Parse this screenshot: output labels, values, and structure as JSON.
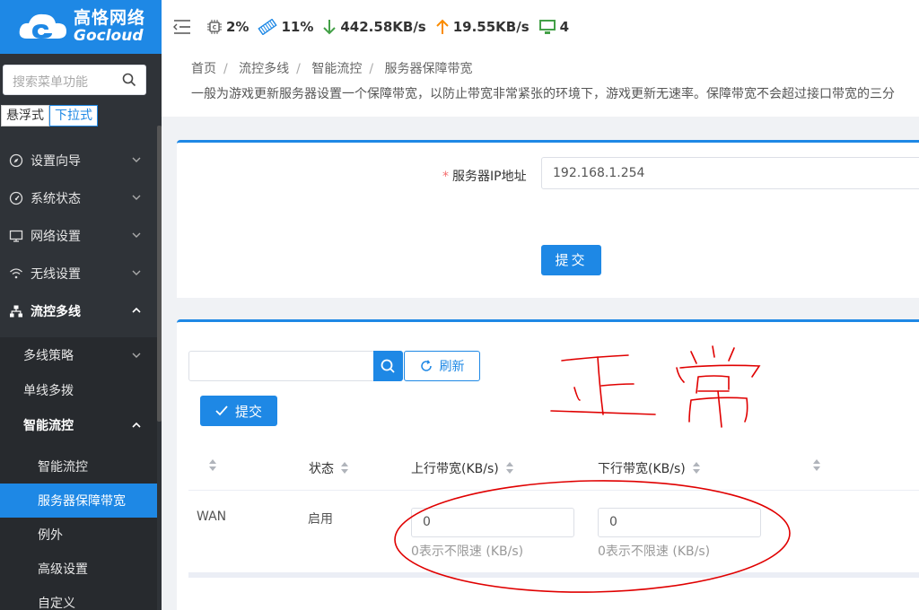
{
  "brand": {
    "name_cn": "高恪网络",
    "name_en": "Gocloud"
  },
  "header": {
    "cpu": "2%",
    "mem": "11%",
    "down": "442.58KB/s",
    "up": "19.55KB/s",
    "clients": "4"
  },
  "sidebar": {
    "search_placeholder": "搜索菜单功能",
    "modes": [
      "悬浮式",
      "下拉式"
    ],
    "items": [
      {
        "label": "设置向导",
        "icon": "compass-icon"
      },
      {
        "label": "系统状态",
        "icon": "gauge-icon"
      },
      {
        "label": "网络设置",
        "icon": "monitor-icon"
      },
      {
        "label": "无线设置",
        "icon": "wifi-icon"
      },
      {
        "label": "流控多线",
        "icon": "network-icon"
      }
    ],
    "sub_items": [
      "多线策略",
      "单线多拨",
      "智能流控"
    ],
    "sub2_items": [
      "智能流控",
      "服务器保障带宽",
      "例外",
      "高级设置",
      "自定义"
    ]
  },
  "breadcrumb": [
    "首页",
    "流控多线",
    "智能流控",
    "服务器保障带宽"
  ],
  "description": "一般为游戏更新服务器设置一个保障带宽，以防止带宽非常紧张的环境下，游戏更新无速率。保障带宽不会超过接口带宽的三分",
  "form": {
    "ip_label": "服务器IP地址",
    "ip_value": "192.168.1.254",
    "submit": "提交"
  },
  "table_panel": {
    "refresh": "刷新",
    "submit": "提交",
    "columns": [
      "状态",
      "上行带宽(KB/s)",
      "下行带宽(KB/s)"
    ],
    "row": {
      "name": "WAN",
      "status": "启用",
      "up_value": "0",
      "down_value": "0",
      "hint": "0表示不限速 (KB/s)"
    }
  },
  "annotation_text": "正常",
  "colors": {
    "primary": "#1e88e5",
    "sidebar": "#2f3338",
    "annotation": "#e00000"
  }
}
